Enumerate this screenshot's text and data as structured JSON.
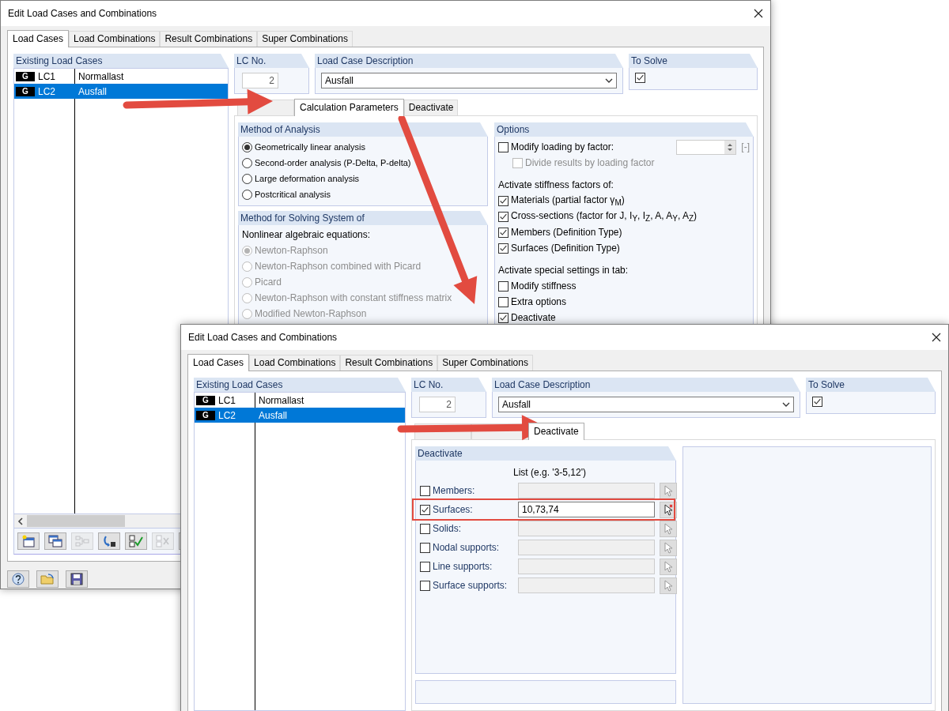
{
  "windows": [
    {
      "kind": "calculation",
      "title": "Edit Load Cases and Combinations",
      "tabs": [
        {
          "label": "Load Cases",
          "selected": true
        },
        {
          "label": "Load Combinations",
          "selected": false
        },
        {
          "label": "Result Combinations",
          "selected": false
        },
        {
          "label": "Super Combinations",
          "selected": false
        }
      ],
      "load_cases": {
        "title": "Existing Load Cases",
        "rows": [
          {
            "type": "G",
            "number": "LC1",
            "description": "Normallast",
            "selected": false
          },
          {
            "type": "G",
            "number": "LC2",
            "description": "Ausfall",
            "selected": true
          }
        ]
      },
      "lc_no": {
        "label": "LC No.",
        "value": "2"
      },
      "description": {
        "label": "Load Case Description",
        "value": "Ausfall"
      },
      "to_solve": {
        "label": "To Solve",
        "checked": true
      },
      "subtabs": [
        {
          "selected": false
        },
        {
          "label": "Calculation Parameters",
          "selected": true
        },
        {
          "label": "Deactivate",
          "selected": false
        }
      ],
      "method_of_analysis": {
        "title": "Method of Analysis",
        "options": [
          {
            "label": "Geometrically linear analysis",
            "selected": true,
            "disabled": false
          },
          {
            "label": "Second-order analysis (P-Delta, P-delta)",
            "selected": false,
            "disabled": false
          },
          {
            "label": "Large deformation analysis",
            "selected": false,
            "disabled": false
          },
          {
            "label": "Postcritical analysis",
            "selected": false,
            "disabled": false
          }
        ]
      },
      "method_for_solving": {
        "title": "Method for Solving System of",
        "subtitle": "Nonlinear algebraic equations:",
        "options": [
          {
            "label": "Newton-Raphson",
            "selected": true,
            "disabled": true
          },
          {
            "label": "Newton-Raphson combined with Picard",
            "selected": false,
            "disabled": true
          },
          {
            "label": "Picard",
            "selected": false,
            "disabled": true
          },
          {
            "label": "Newton-Raphson with constant stiffness matrix",
            "selected": false,
            "disabled": true
          },
          {
            "label": "Modified Newton-Raphson",
            "selected": false,
            "disabled": true
          }
        ]
      },
      "options": {
        "title": "Options",
        "items": [
          {
            "kind": "factor",
            "label": "Modify loading by factor:",
            "checked": false,
            "unit": "[-]"
          },
          {
            "kind": "sub_checkbox",
            "label": "Divide results by loading factor",
            "checked": false,
            "disabled": true
          },
          {
            "kind": "heading",
            "label": "Activate stiffness factors of:"
          },
          {
            "kind": "checkbox",
            "label": "Materials (partial factor γ$_{M}$)",
            "checked": true,
            "disabled": false
          },
          {
            "kind": "checkbox",
            "label": "Cross-sections (factor for J, I$_{Y}$, I$_{Z}$, A, A$_{Y}$, A$_{Z}$)",
            "checked": true,
            "disabled": false
          },
          {
            "kind": "checkbox",
            "label": "Members (Definition Type)",
            "checked": true,
            "disabled": false
          },
          {
            "kind": "checkbox",
            "label": "Surfaces (Definition Type)",
            "checked": true,
            "disabled": false
          },
          {
            "kind": "heading",
            "label": "Activate special settings in tab:"
          },
          {
            "kind": "checkbox",
            "label": "Modify stiffness",
            "checked": false,
            "disabled": false
          },
          {
            "kind": "checkbox",
            "label": "Extra options",
            "checked": false,
            "disabled": false
          },
          {
            "kind": "checkbox",
            "label": "Deactivate",
            "checked": true,
            "disabled": false
          }
        ]
      }
    },
    {
      "kind": "deactivate",
      "title": "Edit Load Cases and Combinations",
      "tabs": [
        {
          "label": "Load Cases",
          "selected": true
        },
        {
          "label": "Load Combinations",
          "selected": false
        },
        {
          "label": "Result Combinations",
          "selected": false
        },
        {
          "label": "Super Combinations",
          "selected": false
        }
      ],
      "load_cases": {
        "title": "Existing Load Cases",
        "rows": [
          {
            "type": "G",
            "number": "LC1",
            "description": "Normallast",
            "selected": false
          },
          {
            "type": "G",
            "number": "LC2",
            "description": "Ausfall",
            "selected": true
          }
        ]
      },
      "lc_no": {
        "label": "LC No.",
        "value": "2"
      },
      "description": {
        "label": "Load Case Description",
        "value": "Ausfall"
      },
      "to_solve": {
        "label": "To Solve",
        "checked": true
      },
      "subtabs": [
        {
          "selected": false
        },
        {
          "selected": false
        },
        {
          "label": "Deactivate",
          "selected": true
        }
      ],
      "deactivate": {
        "title": "Deactivate",
        "list_header": "List (e.g. '3-5,12')",
        "rows": [
          {
            "label": "Members:",
            "checked": false,
            "highlighted": false
          },
          {
            "label": "Surfaces:",
            "checked": true,
            "value": "10,73,74",
            "highlighted": true
          },
          {
            "label": "Solids:",
            "checked": false,
            "highlighted": false
          },
          {
            "label": "Nodal supports:",
            "checked": false,
            "highlighted": false
          },
          {
            "label": "Line supports:",
            "checked": false,
            "highlighted": false
          },
          {
            "label": "Surface supports:",
            "checked": false,
            "highlighted": false
          }
        ]
      }
    }
  ]
}
